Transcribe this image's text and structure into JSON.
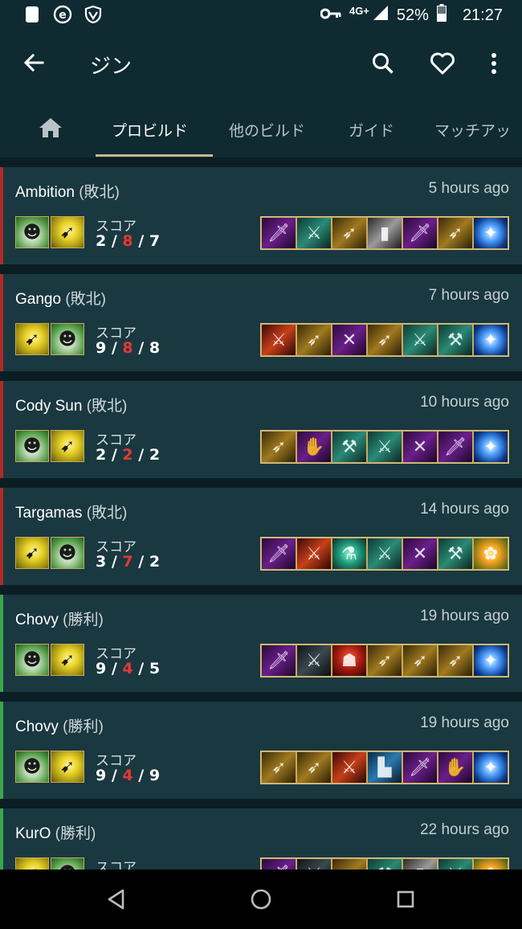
{
  "status_bar": {
    "network": "4G+",
    "battery": "52%",
    "time": "21:27"
  },
  "app_bar": {
    "title": "ジン"
  },
  "tabs": [
    {
      "label": "",
      "icon": "home-icon"
    },
    {
      "label": "プロビルド",
      "active": true
    },
    {
      "label": "他のビルド"
    },
    {
      "label": "ガイド"
    },
    {
      "label": "マッチアッ"
    }
  ],
  "builds": [
    {
      "player": "Ambition",
      "result": "(敗北)",
      "outcome": "loss",
      "time": "5 hours ago",
      "score_label": "スコア",
      "kills": "2",
      "deaths": "8",
      "assists": "7",
      "spells": [
        "heal",
        "flash"
      ],
      "items": [
        "purple-sword",
        "teal-axe",
        "gold-spear",
        "grey-blade",
        "purple-sword",
        "gold-spear",
        "blue-trinket"
      ]
    },
    {
      "player": "Gango",
      "result": "(敗北)",
      "outcome": "loss",
      "time": "7 hours ago",
      "score_label": "スコア",
      "kills": "9",
      "deaths": "8",
      "assists": "8",
      "spells": [
        "flash",
        "heal"
      ],
      "items": [
        "red-blade",
        "gold-spear",
        "purple-cross",
        "gold-spear",
        "teal-axe",
        "teal-scythe",
        "blue-trinket"
      ]
    },
    {
      "player": "Cody Sun",
      "result": "(敗北)",
      "outcome": "loss",
      "time": "10 hours ago",
      "score_label": "スコア",
      "kills": "2",
      "deaths": "2",
      "assists": "2",
      "spells": [
        "heal",
        "flash"
      ],
      "items": [
        "gold-spear",
        "purple-gauntlet",
        "teal-scythe",
        "teal-axe",
        "purple-cross",
        "purple-sword",
        "blue-trinket"
      ]
    },
    {
      "player": "Targamas",
      "result": "(敗北)",
      "outcome": "loss",
      "time": "14 hours ago",
      "score_label": "スコア",
      "kills": "3",
      "deaths": "7",
      "assists": "2",
      "spells": [
        "flash",
        "heal"
      ],
      "items": [
        "purple-sword",
        "red-blade",
        "green-potion",
        "teal-axe",
        "purple-cross",
        "teal-scythe",
        "orange-trinket"
      ]
    },
    {
      "player": "Chovy",
      "result": "(勝利)",
      "outcome": "win",
      "time": "19 hours ago",
      "score_label": "スコア",
      "kills": "9",
      "deaths": "4",
      "assists": "5",
      "spells": [
        "heal",
        "flash"
      ],
      "items": [
        "purple-sword",
        "dark-axe",
        "red-cap",
        "gold-spear",
        "gold-spear",
        "gold-spear",
        "blue-trinket"
      ]
    },
    {
      "player": "Chovy",
      "result": "(勝利)",
      "outcome": "win",
      "time": "19 hours ago",
      "score_label": "スコア",
      "kills": "9",
      "deaths": "4",
      "assists": "9",
      "spells": [
        "heal",
        "flash"
      ],
      "items": [
        "gold-spear",
        "gold-spear",
        "red-blade",
        "blue-boots",
        "purple-sword",
        "purple-gauntlet",
        "blue-trinket"
      ]
    },
    {
      "player": "KurO",
      "result": "(勝利)",
      "outcome": "win",
      "time": "22 hours ago",
      "score_label": "スコア",
      "kills": "",
      "deaths": "",
      "assists": "",
      "spells": [
        "flash",
        "heal"
      ],
      "items": [
        "purple-sword",
        "dark-axe",
        "gold-spear",
        "teal-scythe",
        "grey-blade",
        "teal-axe",
        "orange-trinket"
      ]
    }
  ],
  "colors": {
    "background": "#0a1e24",
    "card": "#1a3840",
    "loss": "#b02a2a",
    "win": "#3aa64a",
    "deaths": "#e53935",
    "tab_indicator": "#c8b88a"
  }
}
